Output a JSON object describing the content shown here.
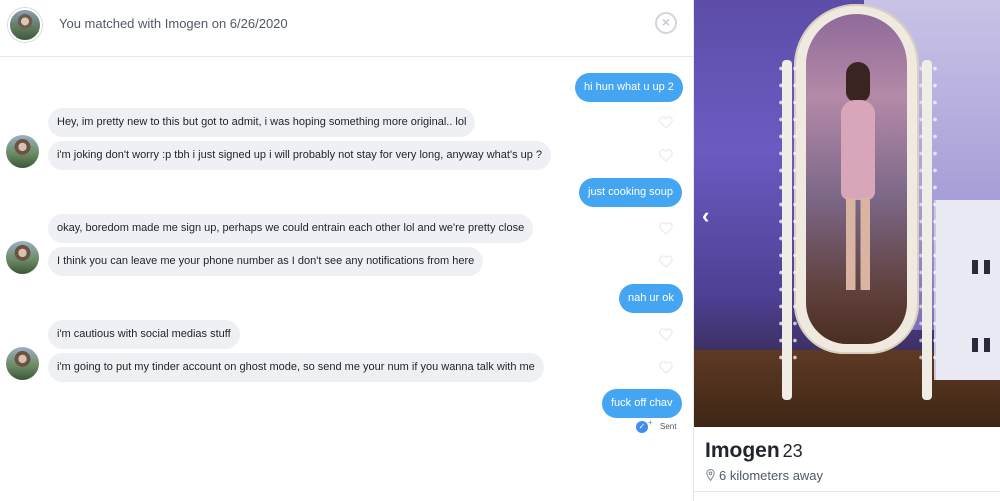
{
  "header": {
    "title": "You matched with Imogen on 6/26/2020",
    "close_icon": "close-icon"
  },
  "messages": [
    {
      "side": "out",
      "text": "hi hun what u up 2"
    },
    {
      "side": "in",
      "text": "Hey, im pretty new to this but got to admit, i was hoping something more original.. lol"
    },
    {
      "side": "in",
      "text": "i'm joking don't worry :p tbh i just signed up i will probably not stay for very long, anyway what's up ?"
    },
    {
      "side": "out",
      "text": "just cooking soup"
    },
    {
      "side": "in",
      "text": "okay, boredom made me sign up, perhaps we could entrain each other lol and  we're pretty close"
    },
    {
      "side": "in",
      "text": "I think you can leave me your phone number as I don't see any notifications from here"
    },
    {
      "side": "out",
      "text": "nah ur ok"
    },
    {
      "side": "in",
      "text": "i'm cautious with social medias stuff"
    },
    {
      "side": "in",
      "text": "i'm going to put my tinder account on ghost mode, so send me your num if you wanna talk with me"
    },
    {
      "side": "out",
      "text": "fuck off chav"
    }
  ],
  "status": {
    "sent_label": "Sent",
    "sent_icon": "sent-check-icon"
  },
  "profile": {
    "name": "Imogen",
    "age": "23",
    "distance": "6 kilometers away",
    "distance_icon": "location-pin-icon",
    "photo_prev_icon": "chevron-left-icon"
  },
  "colors": {
    "outgoing_bubble": "#44a6f2",
    "incoming_bubble": "#eef0f3",
    "text": "#21262e",
    "muted_text": "#505965"
  }
}
